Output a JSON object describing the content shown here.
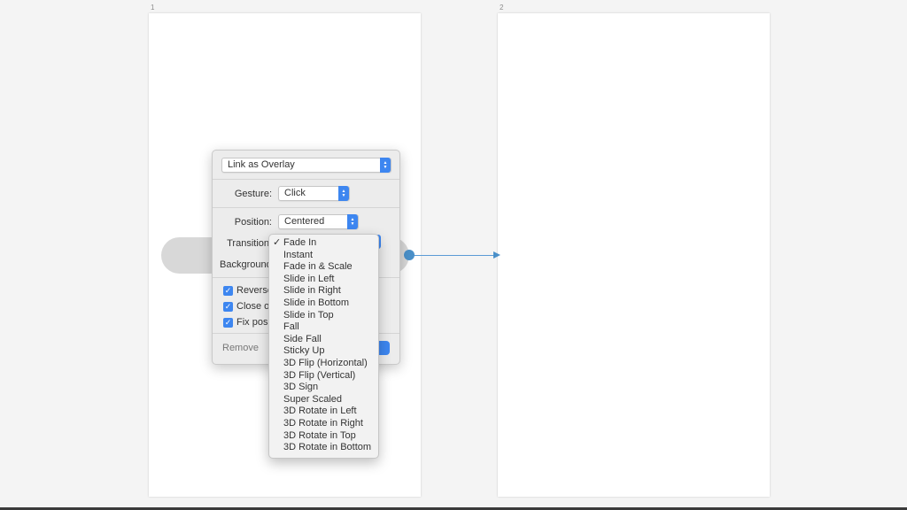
{
  "artboards": [
    {
      "number": "1"
    },
    {
      "number": "2"
    }
  ],
  "popover": {
    "link_type": "Link as Overlay",
    "gesture": {
      "label": "Gesture:",
      "value": "Click"
    },
    "position": {
      "label": "Position:",
      "value": "Centered"
    },
    "transition": {
      "label": "Transition"
    },
    "background": {
      "label": "Background"
    },
    "checkboxes": [
      {
        "label": "Reverse",
        "checked": true
      },
      {
        "label": "Close or",
        "checked": true
      },
      {
        "label": "Fix posit",
        "checked": true
      }
    ],
    "remove_label": "Remove"
  },
  "transition_menu": {
    "selected": "Fade In",
    "check_glyph": "✓",
    "items": [
      "Fade In",
      "Instant",
      "Fade in & Scale",
      "Slide in Left",
      "Slide in Right",
      "Slide in Bottom",
      "Slide in Top",
      "Fall",
      "Side Fall",
      "Sticky Up",
      "3D Flip (Horizontal)",
      "3D Flip (Vertical)",
      "3D Sign",
      "Super Scaled",
      "3D Rotate in Left",
      "3D Rotate in Right",
      "3D Rotate in Top",
      "3D Rotate in Bottom"
    ]
  },
  "icons": {
    "stepper": "up-down-chevron-icon",
    "checkbox": "checkmark-icon",
    "link_arrow": "arrow-right-icon"
  },
  "colors": {
    "accent": "#3d86f0",
    "link": "#4a90c9"
  }
}
